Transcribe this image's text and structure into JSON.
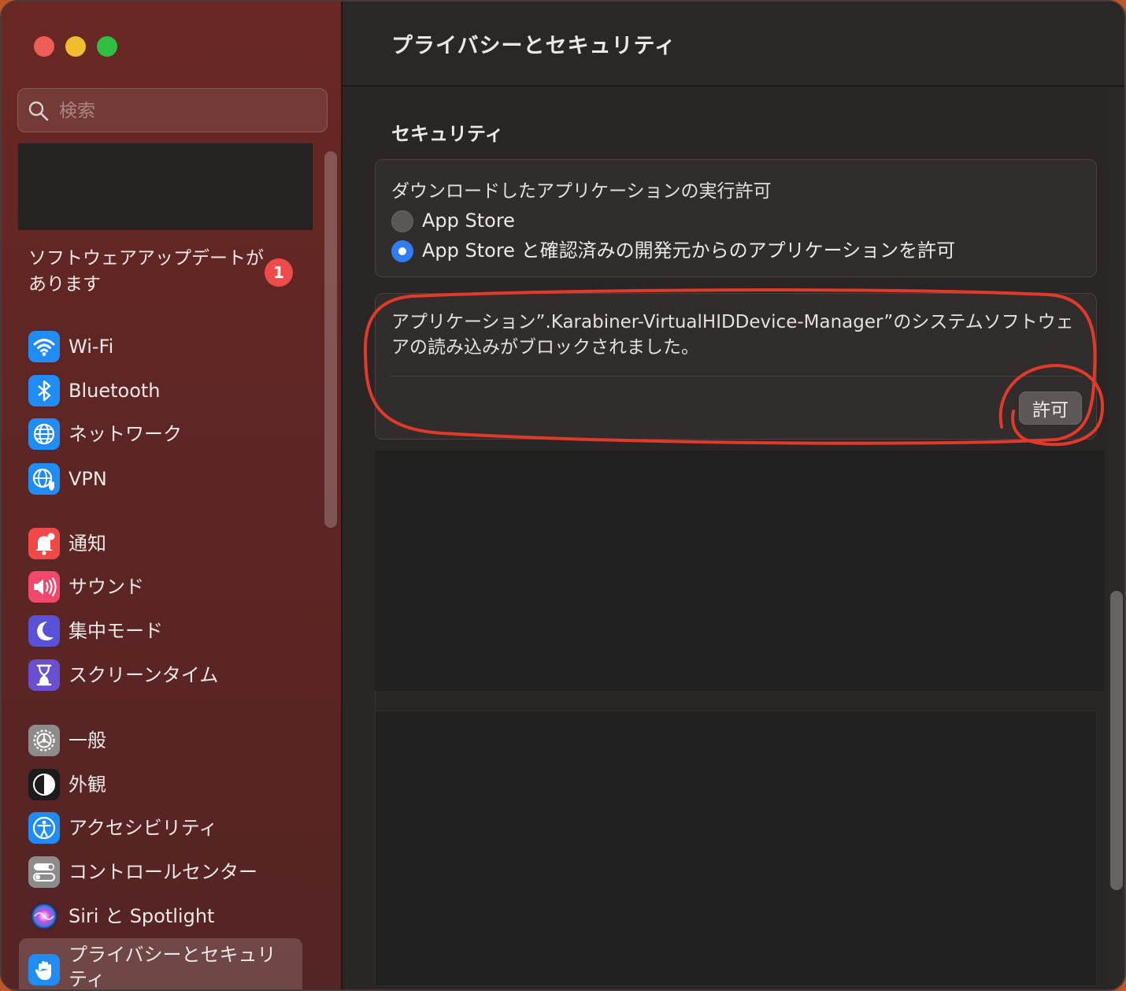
{
  "window": {
    "controls": {
      "close_color": "#ee5e56",
      "minimize_color": "#f2bd2c",
      "zoom_color": "#2fc043"
    }
  },
  "sidebar": {
    "search": {
      "placeholder": "検索",
      "icon": "search-icon"
    },
    "update_notice": {
      "label": "ソフトウェアアップデートがあります",
      "badge": "1"
    },
    "items": [
      {
        "label": "Wi-Fi",
        "icon": "wifi-icon",
        "color": "#1f8df5"
      },
      {
        "label": "Bluetooth",
        "icon": "bluetooth-icon",
        "color": "#1f8df5"
      },
      {
        "label": "ネットワーク",
        "icon": "globe-icon",
        "color": "#1f8df5"
      },
      {
        "label": "VPN",
        "icon": "vpn-globe-icon",
        "color": "#1f8df5"
      },
      {
        "label": "通知",
        "icon": "bell-icon",
        "color": "#f24848"
      },
      {
        "label": "サウンド",
        "icon": "speaker-icon",
        "color": "#f2486e"
      },
      {
        "label": "集中モード",
        "icon": "moon-icon",
        "color": "#5a52d6"
      },
      {
        "label": "スクリーンタイム",
        "icon": "hourglass-icon",
        "color": "#6a4fd0"
      },
      {
        "label": "一般",
        "icon": "gear-icon",
        "color": "#8e8b8b"
      },
      {
        "label": "外観",
        "icon": "appearance-icon",
        "color": "#1c1c1c"
      },
      {
        "label": "アクセシビリティ",
        "icon": "accessibility-icon",
        "color": "#1f8df5"
      },
      {
        "label": "コントロールセンター",
        "icon": "toggles-icon",
        "color": "#8e8b8b"
      },
      {
        "label": "Siri と Spotlight",
        "icon": "siri-icon",
        "color": "#7a3fd0"
      },
      {
        "label": "プライバシーとセキュリティ",
        "icon": "hand-icon",
        "color": "#1f8df5",
        "selected": true
      }
    ]
  },
  "main": {
    "title": "プライバシーとセキュリティ",
    "section_title": "セキュリティ",
    "download_panel": {
      "heading": "ダウンロードしたアプリケーションの実行許可",
      "options": [
        {
          "label": "App Store",
          "selected": false
        },
        {
          "label": "App Store と確認済みの開発元からのアプリケーションを許可",
          "selected": true
        }
      ]
    },
    "block_panel": {
      "message": "アプリケーション”.Karabiner-VirtualHIDDevice-Manager”のシステムソフトウェアの読み込みがブロックされました。",
      "allow_button": "許可"
    }
  },
  "annotation": {
    "color": "#e23a2a"
  }
}
